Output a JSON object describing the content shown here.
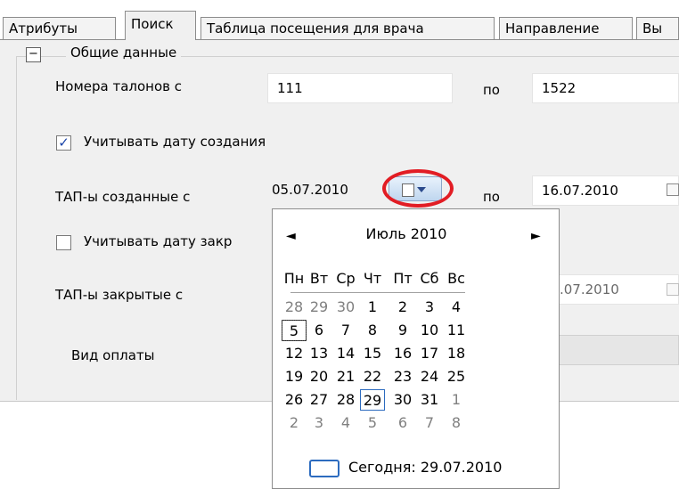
{
  "tabs": [
    {
      "label": "Атрибуты"
    },
    {
      "label": "Поиск"
    },
    {
      "label": "Таблица посещения для врача"
    },
    {
      "label": "Направление"
    },
    {
      "label": "Вы"
    }
  ],
  "group": {
    "collapse_symbol": "−",
    "title": "Общие данные"
  },
  "coupons": {
    "label": "Номера талонов с",
    "from": "111",
    "to_label": "по",
    "to": "1522"
  },
  "created_checkbox": {
    "checked": true,
    "mark": "✓",
    "label": "Учитывать дату создания"
  },
  "created": {
    "label": "ТАП-ы созданные с",
    "from": "05.07.2010",
    "to_label": "по",
    "to": "16.07.2010"
  },
  "closed_checkbox": {
    "checked": false,
    "label": "Учитывать дату закр"
  },
  "closed": {
    "label": "ТАП-ы закрытые с",
    "to": ".07.2010"
  },
  "payment": {
    "label": "Вид оплаты"
  },
  "calendar": {
    "prev": "◄",
    "next": "►",
    "month_label": "Июль 2010",
    "weekdays": [
      "Пн",
      "Вт",
      "Ср",
      "Чт",
      "Пт",
      "Сб",
      "Вс"
    ],
    "weeks": [
      [
        "28",
        "29",
        "30",
        "1",
        "2",
        "3",
        "4"
      ],
      [
        "5",
        "6",
        "7",
        "8",
        "9",
        "10",
        "11"
      ],
      [
        "12",
        "13",
        "14",
        "15",
        "16",
        "17",
        "18"
      ],
      [
        "19",
        "20",
        "21",
        "22",
        "23",
        "24",
        "25"
      ],
      [
        "26",
        "27",
        "28",
        "29",
        "30",
        "31",
        "1"
      ],
      [
        "2",
        "3",
        "4",
        "5",
        "6",
        "7",
        "8"
      ]
    ],
    "today_label": "Сегодня: 29.07.2010"
  },
  "colors": {
    "highlight_ring": "#e21d24",
    "accent": "#2c6bbf",
    "check": "#1a44a8"
  }
}
